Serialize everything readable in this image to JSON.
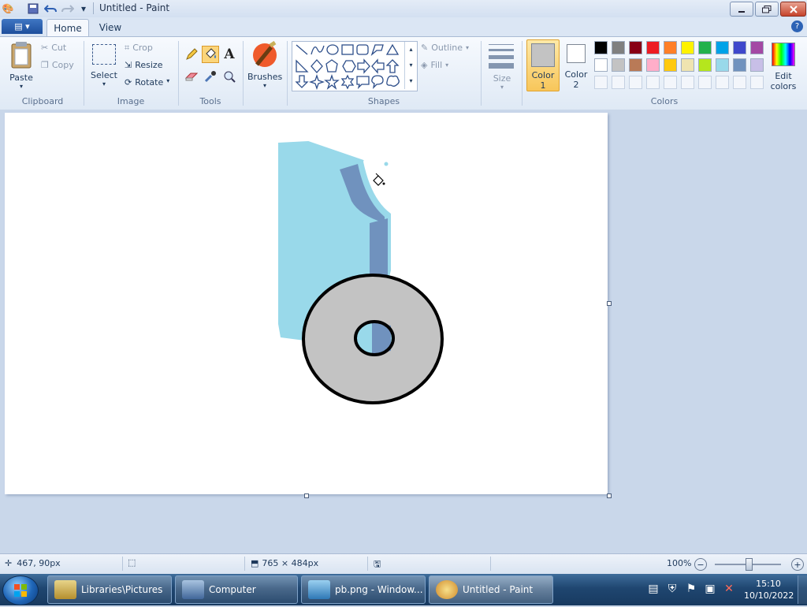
{
  "window": {
    "title": "Untitled - Paint"
  },
  "quick_access": {
    "icons": [
      "paint-app-icon",
      "save-icon",
      "undo-icon",
      "redo-icon",
      "customize-qat-icon"
    ]
  },
  "tabs": {
    "home": "Home",
    "view": "View"
  },
  "ribbon": {
    "clipboard": {
      "paste": "Paste",
      "cut": "Cut",
      "copy": "Copy",
      "group": "Clipboard"
    },
    "image": {
      "select": "Select",
      "crop": "Crop",
      "resize": "Resize",
      "rotate": "Rotate",
      "group": "Image"
    },
    "tools": {
      "group": "Tools",
      "text_glyph": "A"
    },
    "brushes": {
      "label": "Brushes"
    },
    "shapes": {
      "outline": "Outline",
      "fill": "Fill",
      "group": "Shapes"
    },
    "size": {
      "label": "Size"
    },
    "color1": {
      "line1": "Color",
      "line2": "1",
      "value": "#c3c3c3"
    },
    "color2": {
      "line1": "Color",
      "line2": "2",
      "value": "#ffffff"
    },
    "colors_group": "Colors",
    "edit_colors": {
      "line1": "Edit",
      "line2": "colors"
    }
  },
  "palette": {
    "row1": [
      "#000000",
      "#7f7f7f",
      "#880015",
      "#ed1c24",
      "#ff7f27",
      "#fff200",
      "#22b14c",
      "#00a2e8",
      "#3f48cc",
      "#a349a4"
    ],
    "row2": [
      "#ffffff",
      "#c3c3c3",
      "#b97a57",
      "#ffaec9",
      "#ffc90e",
      "#efe4b0",
      "#b5e61d",
      "#99d9ea",
      "#7092be",
      "#c8bfe7"
    ]
  },
  "drawing": {
    "light_blue": "#99d9ea",
    "dark_blue": "#7092be",
    "gray": "#c3c3c3",
    "outline": "#000000"
  },
  "status": {
    "cursor": "467, 90px",
    "canvas_size": "765 × 484px",
    "zoom": "100%"
  },
  "taskbar": {
    "items": [
      "Libraries\\Pictures",
      "Computer",
      "pb.png - Window...",
      "Untitled - Paint"
    ],
    "time": "15:10",
    "date": "10/10/2022"
  }
}
